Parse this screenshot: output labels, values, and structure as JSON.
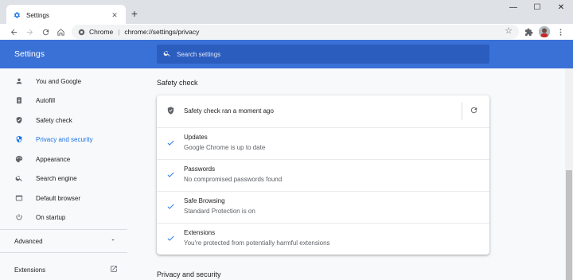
{
  "browser": {
    "tab_title": "Settings",
    "tab_close": "✕",
    "new_tab": "+",
    "window_controls": {
      "minimize": "—",
      "maximize": "☐",
      "close": "✕"
    },
    "omnibox": {
      "site": "Chrome",
      "separator": "|",
      "url": "chrome://settings/privacy"
    }
  },
  "header": {
    "title": "Settings",
    "search_placeholder": "Search settings",
    "accent": "#3a71d6"
  },
  "sidebar": {
    "items": [
      {
        "label": "You and Google",
        "icon": "person-icon"
      },
      {
        "label": "Autofill",
        "icon": "clipboard-icon"
      },
      {
        "label": "Safety check",
        "icon": "shield-icon"
      },
      {
        "label": "Privacy and security",
        "icon": "shield-half-icon",
        "active": true
      },
      {
        "label": "Appearance",
        "icon": "palette-icon"
      },
      {
        "label": "Search engine",
        "icon": "search-icon"
      },
      {
        "label": "Default browser",
        "icon": "browser-window-icon"
      },
      {
        "label": "On startup",
        "icon": "power-icon"
      }
    ],
    "advanced": "Advanced",
    "extensions": "Extensions"
  },
  "main": {
    "safety_check_title": "Safety check",
    "status_message": "Safety check ran a moment ago",
    "items": [
      {
        "title": "Updates",
        "subtitle": "Google Chrome is up to date"
      },
      {
        "title": "Passwords",
        "subtitle": "No compromised passwords found"
      },
      {
        "title": "Safe Browsing",
        "subtitle": "Standard Protection is on"
      },
      {
        "title": "Extensions",
        "subtitle": "You're protected from potentially harmful extensions"
      }
    ],
    "privacy_title": "Privacy and security"
  }
}
